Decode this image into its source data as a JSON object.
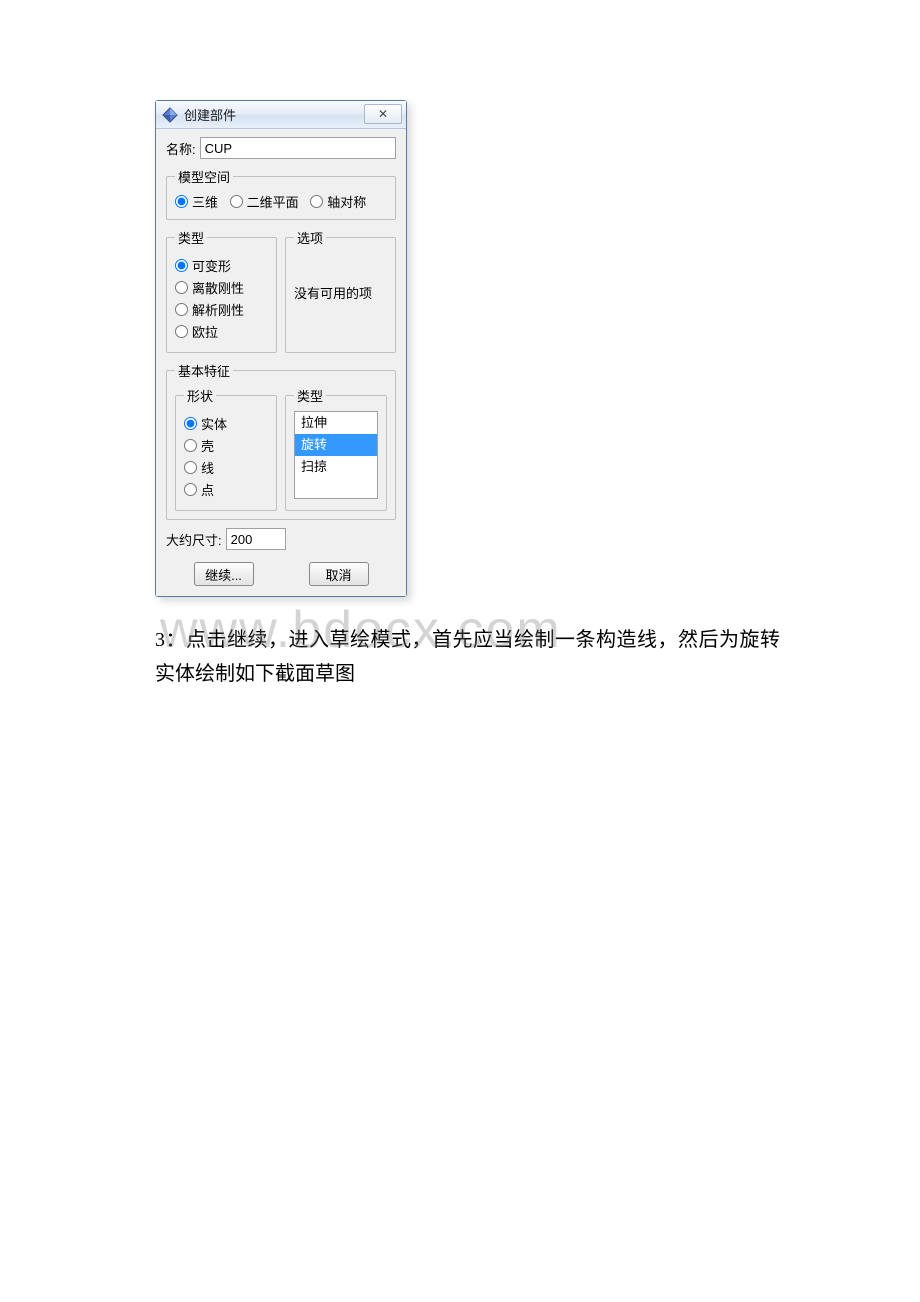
{
  "dialog": {
    "title": "创建部件",
    "close_symbol": "✕",
    "name_label": "名称:",
    "name_value": "CUP",
    "model_space": {
      "legend": "模型空间",
      "options": [
        "三维",
        "二维平面",
        "轴对称"
      ],
      "selected": 0
    },
    "type_group": {
      "legend": "类型",
      "options": [
        "可变形",
        "离散刚性",
        "解析刚性",
        "欧拉"
      ],
      "selected": 0
    },
    "option_group": {
      "legend": "选项",
      "empty_text": "没有可用的项"
    },
    "base_feature": {
      "legend": "基本特征",
      "shape": {
        "legend": "形状",
        "options": [
          "实体",
          "壳",
          "线",
          "点"
        ],
        "selected": 0
      },
      "type_list": {
        "legend": "类型",
        "options": [
          "拉伸",
          "旋转",
          "扫掠"
        ],
        "selected": 1
      }
    },
    "approx_size_label": "大约尺寸:",
    "approx_size_value": "200",
    "continue_label": "继续...",
    "cancel_label": "取消"
  },
  "instruction_text": "3：点击继续，进入草绘模式，首先应当绘制一条构造线，然后为旋转实体绘制如下截面草图",
  "watermark": "www.bdocx.com"
}
